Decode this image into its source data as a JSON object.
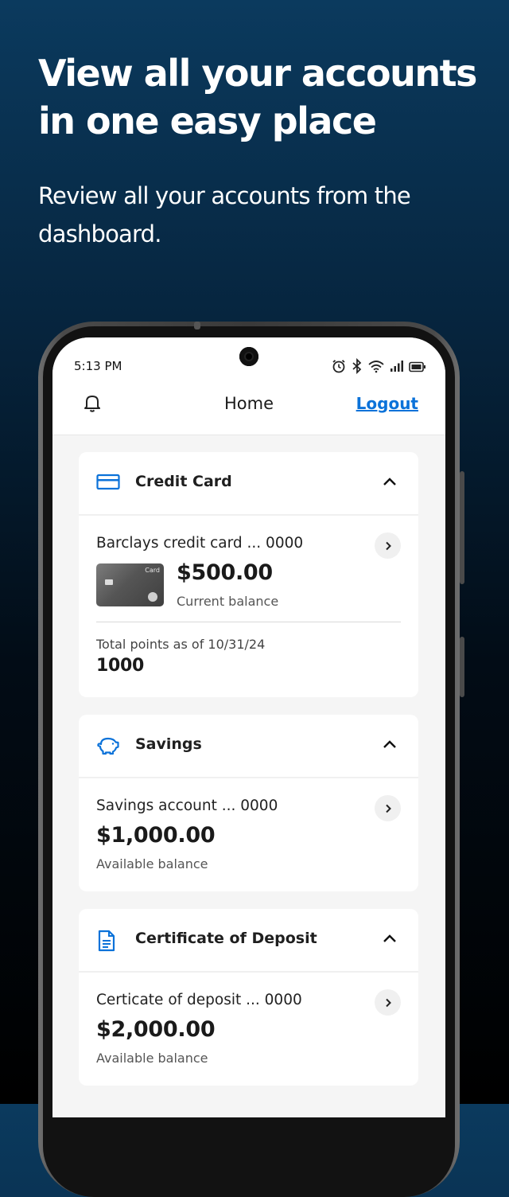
{
  "promo": {
    "headline": "View all your accounts in one easy place",
    "subline": "Review all your accounts from the dashboard."
  },
  "status_bar": {
    "time": "5:13 PM",
    "icons": [
      "alarm-icon",
      "bluetooth-icon",
      "wifi-icon",
      "signal-icon",
      "battery-icon"
    ]
  },
  "app_bar": {
    "title": "Home",
    "logout_label": "Logout",
    "notification_icon": "bell-icon"
  },
  "accounts": {
    "credit_card": {
      "section_title": "Credit Card",
      "account_name": "Barclays credit card ... 0000",
      "card_image_text": "Card",
      "balance": "$500.00",
      "balance_label": "Current balance",
      "points_label": "Total points as of 10/31/24",
      "points_value": "1000"
    },
    "savings": {
      "section_title": "Savings",
      "account_name": "Savings account ... 0000",
      "balance": "$1,000.00",
      "balance_label": "Available balance"
    },
    "cd": {
      "section_title": "Certificate of Deposit",
      "account_name": "Certicate of deposit ... 0000",
      "balance": "$2,000.00",
      "balance_label": "Available balance"
    }
  },
  "colors": {
    "accent": "#0b72d9",
    "background_top": "#0b3a5e",
    "background_bottom": "#000000"
  }
}
